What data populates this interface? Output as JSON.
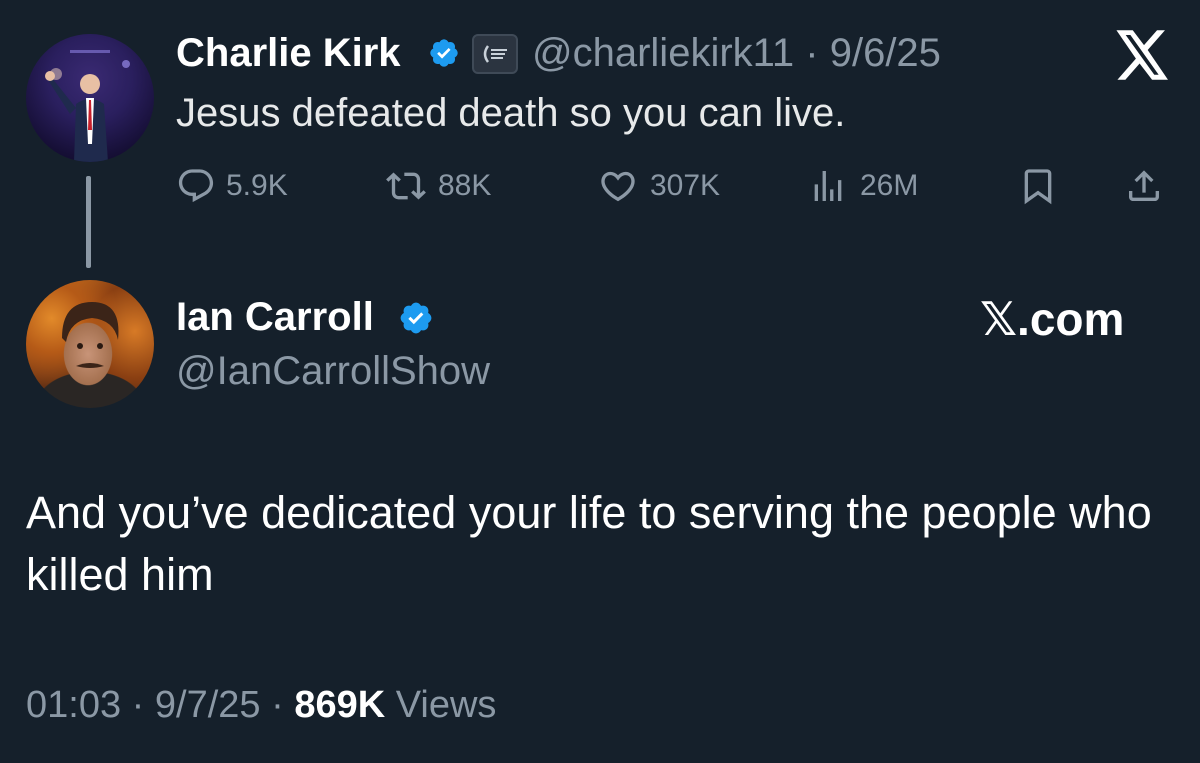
{
  "quoted_tweet": {
    "display_name": "Charlie Kirk",
    "handle": "@charliekirk11",
    "date": "9/6/25",
    "handle_date": "@charliekirk11 · 9/6/25",
    "text": "Jesus defeated death so you can live.",
    "verified": true,
    "affiliation_icon": "organization-badge",
    "actions": {
      "replies": "5.9K",
      "reposts": "88K",
      "likes": "307K",
      "views": "26M"
    }
  },
  "main_tweet": {
    "display_name": "Ian Carroll",
    "handle": "@IanCarrollShow",
    "verified": true,
    "text": "And you’ve dedicated your life to serving the people who killed him",
    "time": "01:03",
    "date": "9/7/25",
    "views_count": "869K",
    "views_label": "Views"
  },
  "branding": {
    "logo_glyph": "X",
    "site": "𝕏.com"
  },
  "colors": {
    "background": "#15202b",
    "primary_text": "#e7e9ea",
    "secondary_text": "#8b98a5",
    "verified_blue": "#1d9bf0"
  }
}
